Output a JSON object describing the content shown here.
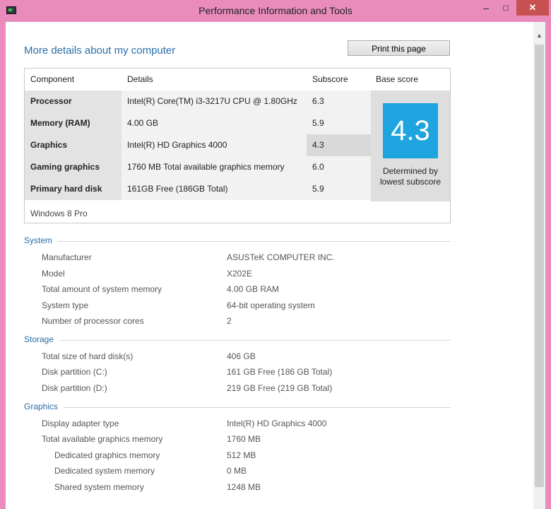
{
  "window": {
    "title": "Performance Information and Tools",
    "minimize_icon": "minimize-icon",
    "maximize_icon": "maximize-icon",
    "close_icon": "close-icon"
  },
  "header": {
    "heading": "More details about my computer",
    "print_label": "Print this page"
  },
  "score_table": {
    "columns": [
      "Component",
      "Details",
      "Subscore",
      "Base score"
    ],
    "rows": [
      {
        "component": "Processor",
        "details": "Intel(R) Core(TM) i3-3217U CPU @ 1.80GHz",
        "subscore": "6.3"
      },
      {
        "component": "Memory (RAM)",
        "details": "4.00 GB",
        "subscore": "5.9"
      },
      {
        "component": "Graphics",
        "details": "Intel(R) HD Graphics 4000",
        "subscore": "4.3"
      },
      {
        "component": "Gaming graphics",
        "details": "1760 MB Total available graphics memory",
        "subscore": "6.0"
      },
      {
        "component": "Primary hard disk",
        "details": "161GB Free (186GB Total)",
        "subscore": "5.9"
      }
    ],
    "base_score": "4.3",
    "base_note": "Determined by lowest subscore",
    "tile_color": "#1ea4df",
    "os": "Windows 8 Pro"
  },
  "system": {
    "title": "System",
    "items": [
      {
        "label": "Manufacturer",
        "value": "ASUSTeK COMPUTER INC."
      },
      {
        "label": "Model",
        "value": "X202E"
      },
      {
        "label": "Total amount of system memory",
        "value": "4.00 GB RAM"
      },
      {
        "label": "System type",
        "value": "64-bit operating system"
      },
      {
        "label": "Number of processor cores",
        "value": "2"
      }
    ]
  },
  "storage": {
    "title": "Storage",
    "items": [
      {
        "label": "Total size of hard disk(s)",
        "value": "406 GB"
      },
      {
        "label": "Disk partition (C:)",
        "value": "161 GB Free (186 GB Total)"
      },
      {
        "label": "Disk partition (D:)",
        "value": "219 GB Free (219 GB Total)"
      }
    ]
  },
  "graphics": {
    "title": "Graphics",
    "items": [
      {
        "label": "Display adapter type",
        "value": "Intel(R) HD Graphics 4000"
      },
      {
        "label": "Total available graphics memory",
        "value": "1760 MB"
      },
      {
        "label": "Dedicated graphics memory",
        "value": "512 MB"
      },
      {
        "label": "Dedicated system memory",
        "value": "0 MB"
      },
      {
        "label": "Shared system memory",
        "value": "1248 MB"
      }
    ]
  }
}
